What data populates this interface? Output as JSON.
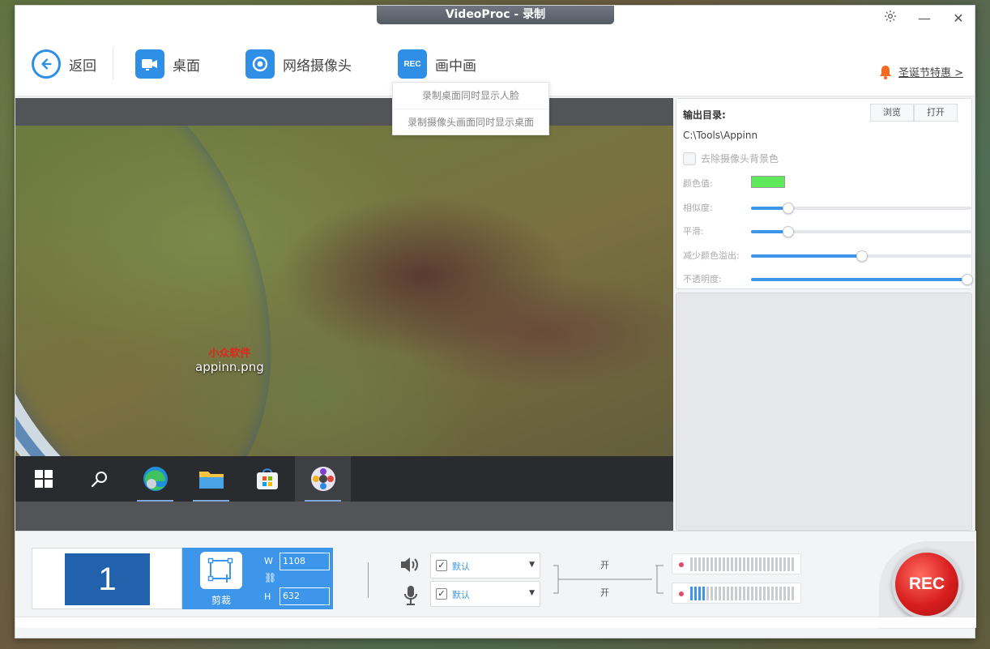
{
  "window": {
    "title": "VideoProc - 录制"
  },
  "toolbar": {
    "back": "返回",
    "desktop": "桌面",
    "webcam": "网络摄像头",
    "pip": "画中画",
    "pip_icon_text": "REC",
    "promo": "圣诞节特惠 >"
  },
  "pip_menu": {
    "item1": "录制桌面同时显示人脸",
    "item2": "录制摄像头画面同时显示桌面"
  },
  "preview": {
    "file_label": "appinn.png",
    "file_logo": "小众软件"
  },
  "panel": {
    "output_dir_label": "输出目录:",
    "browse": "浏览",
    "open": "打开",
    "output_path": "C:\\Tools\\Appinn",
    "remove_bg": "去除摄像头背景色",
    "color_label": "颜色值:",
    "key_color": "#5ee85a",
    "similarity": "相似度:",
    "smooth": "平滑:",
    "spill": "减少颜色溢出:",
    "opacity": "不透明度:",
    "similarity_value": 0.15,
    "smooth_value": 0.15,
    "spill_value": 0.5,
    "opacity_value": 1.0
  },
  "bottom": {
    "screen_number": "1",
    "crop": "剪裁",
    "w_label": "W",
    "h_label": "H",
    "width": "1108",
    "height": "632",
    "speaker_device": "默认",
    "mic_device": "默认",
    "speaker_state": "开",
    "mic_state": "开",
    "rec": "REC",
    "speaker_level": 0,
    "mic_level": 4
  },
  "colors": {
    "accent": "#3d96ea",
    "rec_red": "#d81e1e"
  }
}
